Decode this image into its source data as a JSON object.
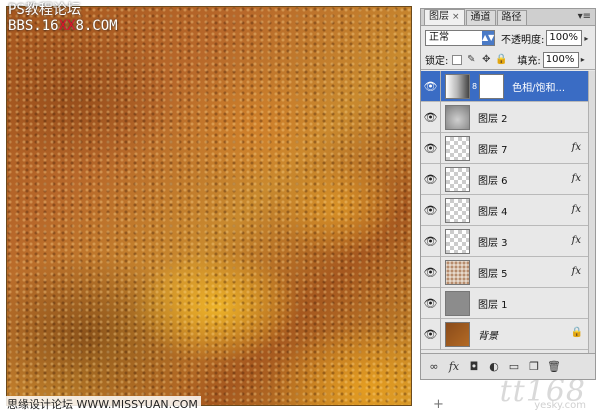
{
  "watermark": {
    "line1": "PS教程论坛",
    "line2_a": "BBS.16",
    "line2_b": "XX",
    "line2_c": "8.COM",
    "bottom": "思缘设计论坛 WWW.MISSYUAN.COM"
  },
  "logo": {
    "text": "tt168",
    "sub": "yesky.com"
  },
  "panel": {
    "tabs": [
      {
        "label": "图层",
        "close": "×",
        "active": true
      },
      {
        "label": "通道",
        "active": false
      },
      {
        "label": "路径",
        "active": false
      }
    ],
    "menu_icon": "▾≡",
    "blend_mode": "正常",
    "opacity_label": "不透明度:",
    "opacity_value": "100%",
    "lock_label": "锁定:",
    "fill_label": "填充:",
    "fill_value": "100%",
    "layers": [
      {
        "name": "色相/饱和...",
        "thumb": "adjustment",
        "has_mask": true,
        "fx": false,
        "selected": true
      },
      {
        "name": "图层 2",
        "thumb": "grey-cloud",
        "fx": false
      },
      {
        "name": "图层 7",
        "thumb": "transparent",
        "fx": true
      },
      {
        "name": "图层 6",
        "thumb": "transparent",
        "fx": true
      },
      {
        "name": "图层 4",
        "thumb": "transparent",
        "fx": true
      },
      {
        "name": "图层 3",
        "thumb": "transparent",
        "fx": true
      },
      {
        "name": "图层 5",
        "thumb": "texture",
        "fx": true
      },
      {
        "name": "图层 1",
        "thumb": "grey",
        "fx": false
      },
      {
        "name": "背景",
        "thumb": "brown",
        "fx": false,
        "locked": true,
        "italic": true
      }
    ],
    "fx_label": "fx",
    "bottom_icons": [
      "link-icon",
      "fx-icon",
      "mask-icon",
      "adjustment-icon",
      "folder-icon",
      "new-layer-icon",
      "trash-icon"
    ]
  },
  "colors": {
    "selected": "#3a6cc4",
    "panel_bg": "#e8e8e8",
    "watermark_red": "#e0102a"
  }
}
